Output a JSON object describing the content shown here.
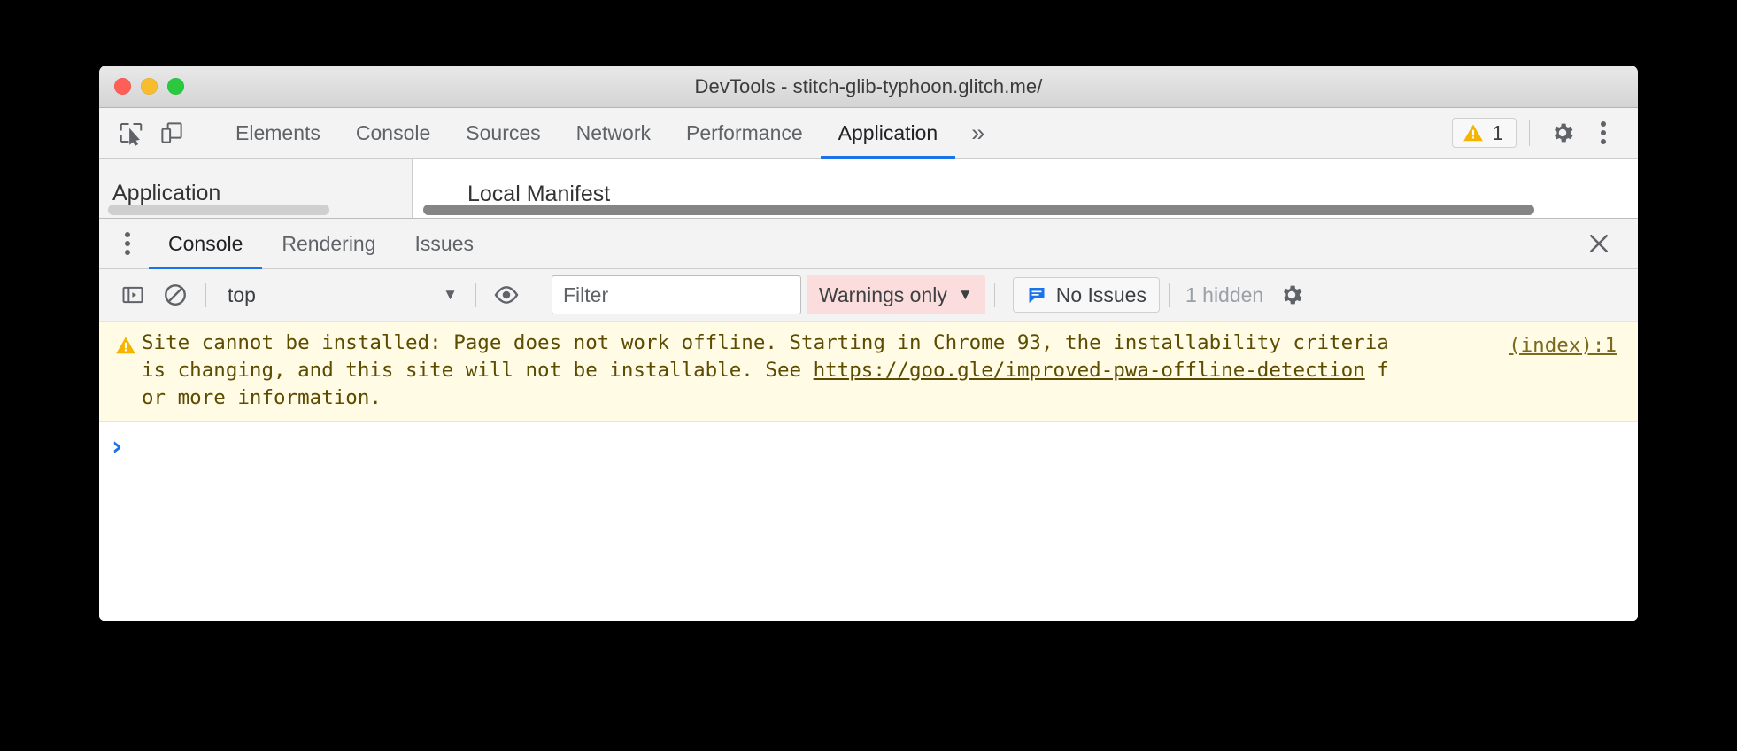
{
  "window": {
    "title": "DevTools - stitch-glib-typhoon.glitch.me/",
    "traffic_lights": [
      "close",
      "minimize",
      "zoom"
    ],
    "colors": {
      "close": "#ff5f57",
      "minimize": "#f7bd2e",
      "zoom": "#2ac940",
      "accent_blue": "#1a73e8",
      "warning_yellow": "#f5a623",
      "warning_bg": "#fffbe5",
      "level_filter_bg": "#fbdddd"
    }
  },
  "toolbar": {
    "inspect_icon": "inspect-element-icon",
    "device_icon": "device-toolbar-icon",
    "tabs": [
      {
        "label": "Elements",
        "active": false
      },
      {
        "label": "Console",
        "active": false
      },
      {
        "label": "Sources",
        "active": false
      },
      {
        "label": "Network",
        "active": false
      },
      {
        "label": "Performance",
        "active": false
      },
      {
        "label": "Application",
        "active": true
      }
    ],
    "more_tabs": "»",
    "warnings_badge": {
      "icon": "warning-triangle-icon",
      "count": "1"
    },
    "settings_icon": "gear-icon",
    "main_menu_icon": "kebab-menu-icon"
  },
  "panel_sliver": {
    "sidebar_title": "Application",
    "content_title": "Local Manifest"
  },
  "drawer": {
    "menu_icon": "kebab-menu-icon",
    "tabs": [
      {
        "label": "Console",
        "active": true
      },
      {
        "label": "Rendering",
        "active": false
      },
      {
        "label": "Issues",
        "active": false
      }
    ],
    "close_icon": "close-icon"
  },
  "console_toolbar": {
    "sidebar_toggle_icon": "console-sidebar-icon",
    "clear_icon": "clear-console-icon",
    "context": {
      "value": "top",
      "caret": "▼"
    },
    "eye_icon": "live-expression-eye-icon",
    "filter": {
      "value": "",
      "placeholder": "Filter"
    },
    "level": {
      "value": "Warnings only",
      "caret": "▼"
    },
    "issues": {
      "icon": "issues-message-icon",
      "label": "No Issues"
    },
    "hidden": "1 hidden",
    "settings_icon": "gear-icon"
  },
  "console": {
    "message": {
      "icon": "warning-triangle-icon",
      "text_before_link": "Site cannot be installed: Page does not work offline. Starting in Chrome 93, the installability criteria is changing, and this site will not be installable. See ",
      "link": "https://goo.gle/improved-pwa-offline-detection",
      "text_after_link": " for more information.",
      "source": "(index):1"
    },
    "prompt_caret": "›"
  }
}
